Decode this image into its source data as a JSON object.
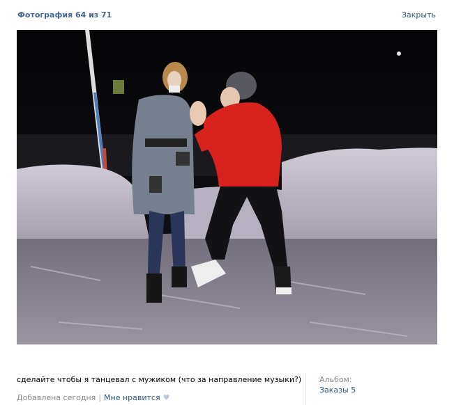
{
  "header": {
    "title": "Фотография 64 из 71",
    "close_label": "Закрыть"
  },
  "photo": {
    "caption": "сделайте чтобы я танцевал с мужиком (что за направление музыки?)"
  },
  "meta": {
    "added": "Добавлена сегодня",
    "separator": "|",
    "like_label": "Мне нравится"
  },
  "album": {
    "label": "Альбом:",
    "name": "Заказы 5"
  },
  "icons": {
    "like": "heart-icon"
  },
  "colors": {
    "link": "#2b587a",
    "title": "#45688e",
    "muted": "#888888"
  }
}
